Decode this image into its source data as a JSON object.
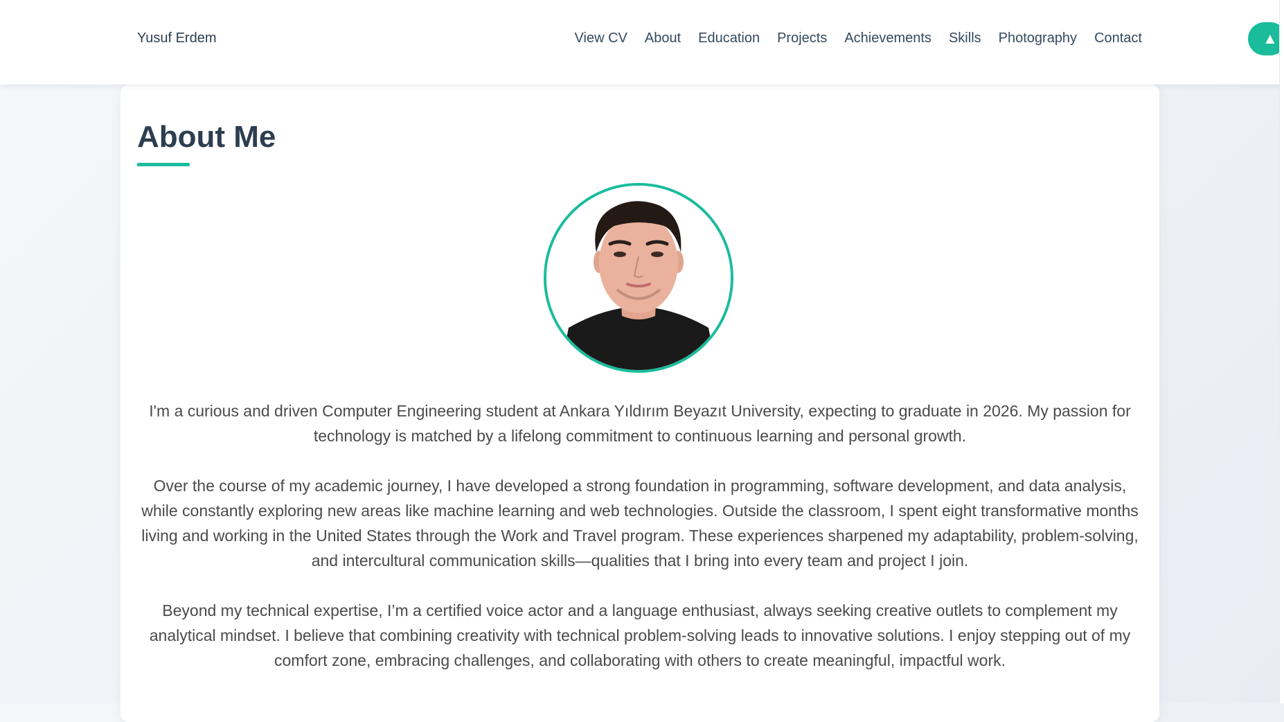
{
  "nav": {
    "brand": "Yusuf Erdem",
    "links": [
      "View CV",
      "About",
      "Education",
      "Projects",
      "Achievements",
      "Skills",
      "Photography",
      "Contact"
    ],
    "scroll_top_icon": "▲"
  },
  "about": {
    "title": "About Me",
    "paragraphs": [
      "I'm a curious and driven Computer Engineering student at Ankara Yıldırım Beyazıt University, expecting to graduate in 2026. My passion for technology is matched by a lifelong commitment to continuous learning and personal growth.",
      "Over the course of my academic journey, I have developed a strong foundation in programming, software development, and data analysis, while constantly exploring new areas like machine learning and web technologies. Outside the classroom, I spent eight transformative months living and working in the United States through the Work and Travel program. These experiences sharpened my adaptability, problem-solving, and intercultural communication skills—qualities that I bring into every team and project I join.",
      "Beyond my technical expertise, I’m a certified voice actor and a language enthusiast, always seeking creative outlets to complement my analytical mindset. I believe that combining creativity with technical problem-solving leads to innovative solutions. I enjoy stepping out of my comfort zone, embracing challenges, and collaborating with others to create meaningful, impactful work."
    ]
  },
  "colors": {
    "accent": "#1abc9c",
    "heading": "#2c3e50",
    "text": "#4a4a4a"
  },
  "icons": {
    "scroll_top": "arrow-up-icon",
    "profile": "profile-photo"
  }
}
